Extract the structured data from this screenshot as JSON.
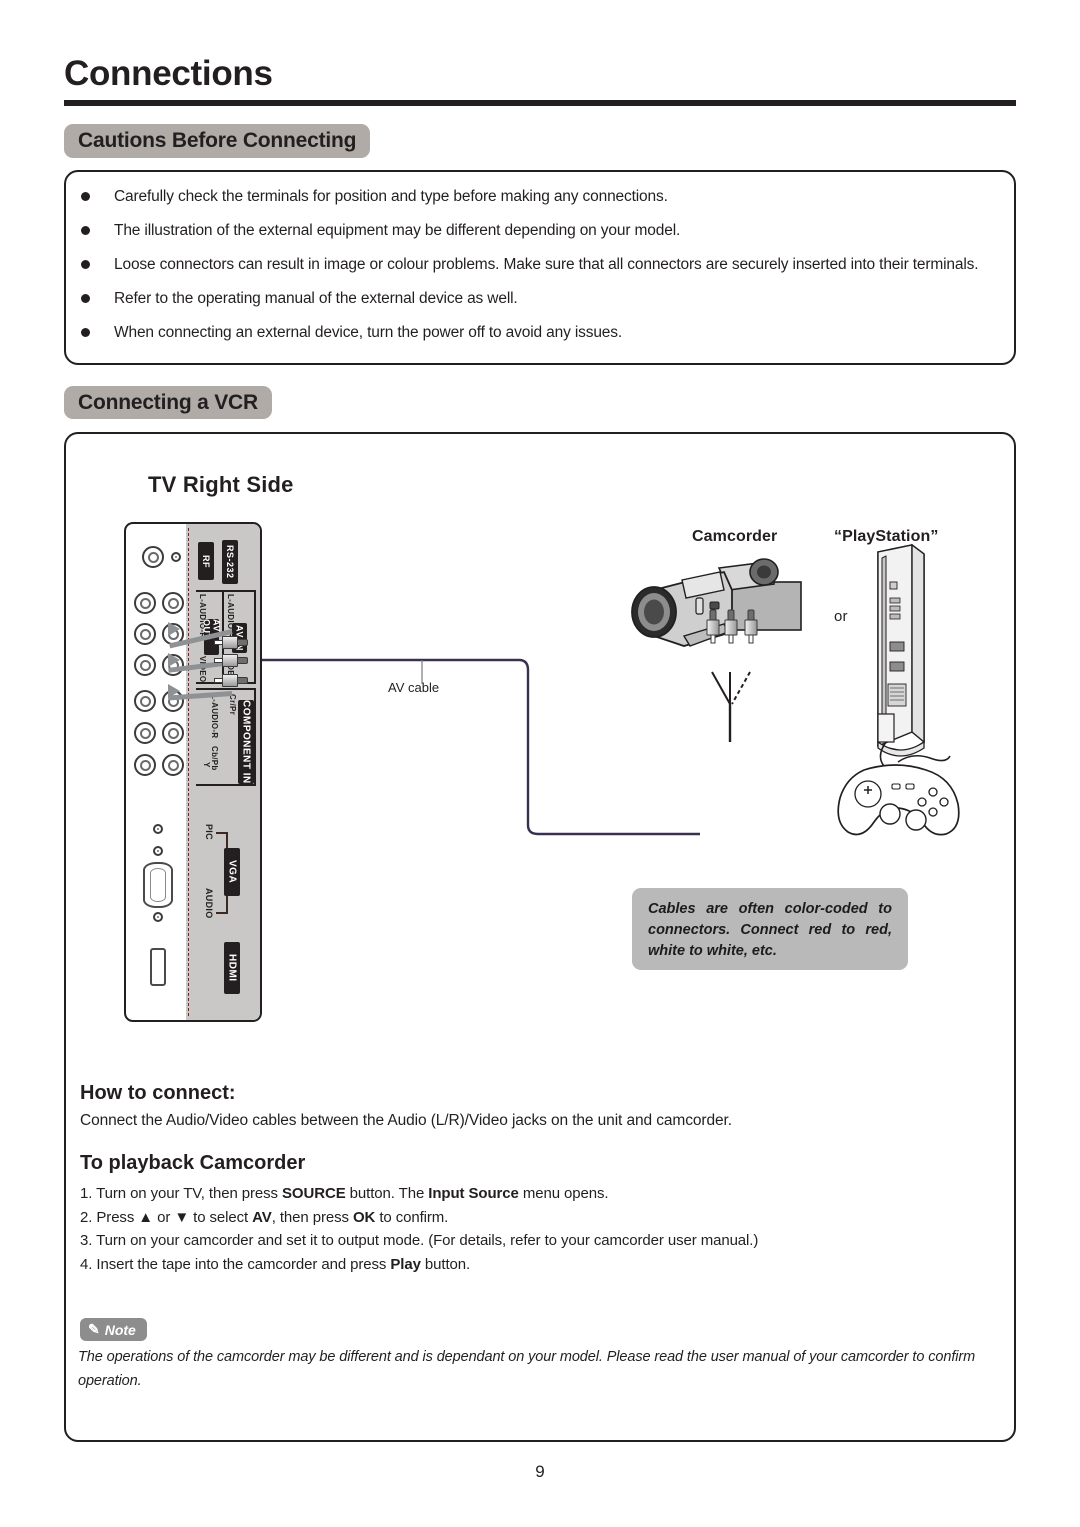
{
  "page": {
    "title": "Connections",
    "number": "9"
  },
  "sections": {
    "cautions": {
      "heading": "Cautions Before Connecting",
      "bullets": [
        "Carefully check the terminals for position and type before making any connections.",
        "The illustration of the external equipment may be different depending on your model.",
        "Loose connectors can result in image or colour problems. Make sure that all connectors are securely inserted into their terminals.",
        "Refer to the operating manual of the external device as well.",
        "When connecting an external device, turn the power off to avoid any issues."
      ]
    },
    "vcr": {
      "heading": "Connecting a VCR",
      "diagram": {
        "panel_title": "TV Right Side",
        "ports": {
          "rf": "RF",
          "rs232": "RS-232",
          "av_out": "AV OUT",
          "av_in": "AV IN",
          "audio_lr_1": "L-AUDIO-R",
          "audio_lr_2": "L-AUDIO-R",
          "video_1": "VIDEO",
          "video_2": "VIDEO",
          "component_in": "COMPONENT IN",
          "component_audio": "L-AUDIO-R",
          "component_cb": "Cb/Pb",
          "component_cr": "Cr/Pr",
          "component_y": "Y",
          "vga": "VGA",
          "vga_pic": "PIC",
          "vga_audio": "AUDIO",
          "hdmi": "HDMI"
        },
        "cable_label": "AV cable",
        "devices": {
          "camcorder": "Camcorder",
          "playstation": "“PlayStation”",
          "or": "or"
        },
        "tip": "Cables are often color-coded to connectors. Connect red to red, white to white, etc."
      },
      "how_to_connect": {
        "heading": "How to connect:",
        "text": "Connect the Audio/Video cables between the Audio (L/R)/Video jacks on the unit and camcorder."
      },
      "playback": {
        "heading": "To playback Camcorder",
        "steps": [
          {
            "num": "1.",
            "parts": [
              {
                "t": "Turn on your TV,  then press ",
                "b": false
              },
              {
                "t": "SOURCE",
                "b": true
              },
              {
                "t": " button. The ",
                "b": false
              },
              {
                "t": "Input Source",
                "b": true
              },
              {
                "t": " menu opens.",
                "b": false
              }
            ]
          },
          {
            "num": "2.",
            "parts": [
              {
                "t": "Press ▲ or ▼ to select ",
                "b": false
              },
              {
                "t": "AV",
                "b": true
              },
              {
                "t": ", then press ",
                "b": false
              },
              {
                "t": "OK",
                "b": true
              },
              {
                "t": " to confirm.",
                "b": false
              }
            ]
          },
          {
            "num": "3.",
            "parts": [
              {
                "t": "Turn on your camcorder and set it to output mode. (For details, refer to your camcorder user manual.)",
                "b": false
              }
            ]
          },
          {
            "num": "4.",
            "parts": [
              {
                "t": "Insert the tape into the camcorder and press ",
                "b": false
              },
              {
                "t": "Play",
                "b": true
              },
              {
                "t": " button.",
                "b": false
              }
            ]
          }
        ]
      },
      "note": {
        "badge": "Note",
        "text": "The operations of the camcorder may be different and is dependant on your model. Please read the user manual of your camcorder to confirm operation."
      }
    }
  },
  "colors": {
    "pill_grey": "#b0aba6",
    "panel_grey": "#c9c8c6",
    "tip_grey": "#b9b9b9",
    "ink": "#231f20",
    "arrow_grey": "#8f9295"
  }
}
